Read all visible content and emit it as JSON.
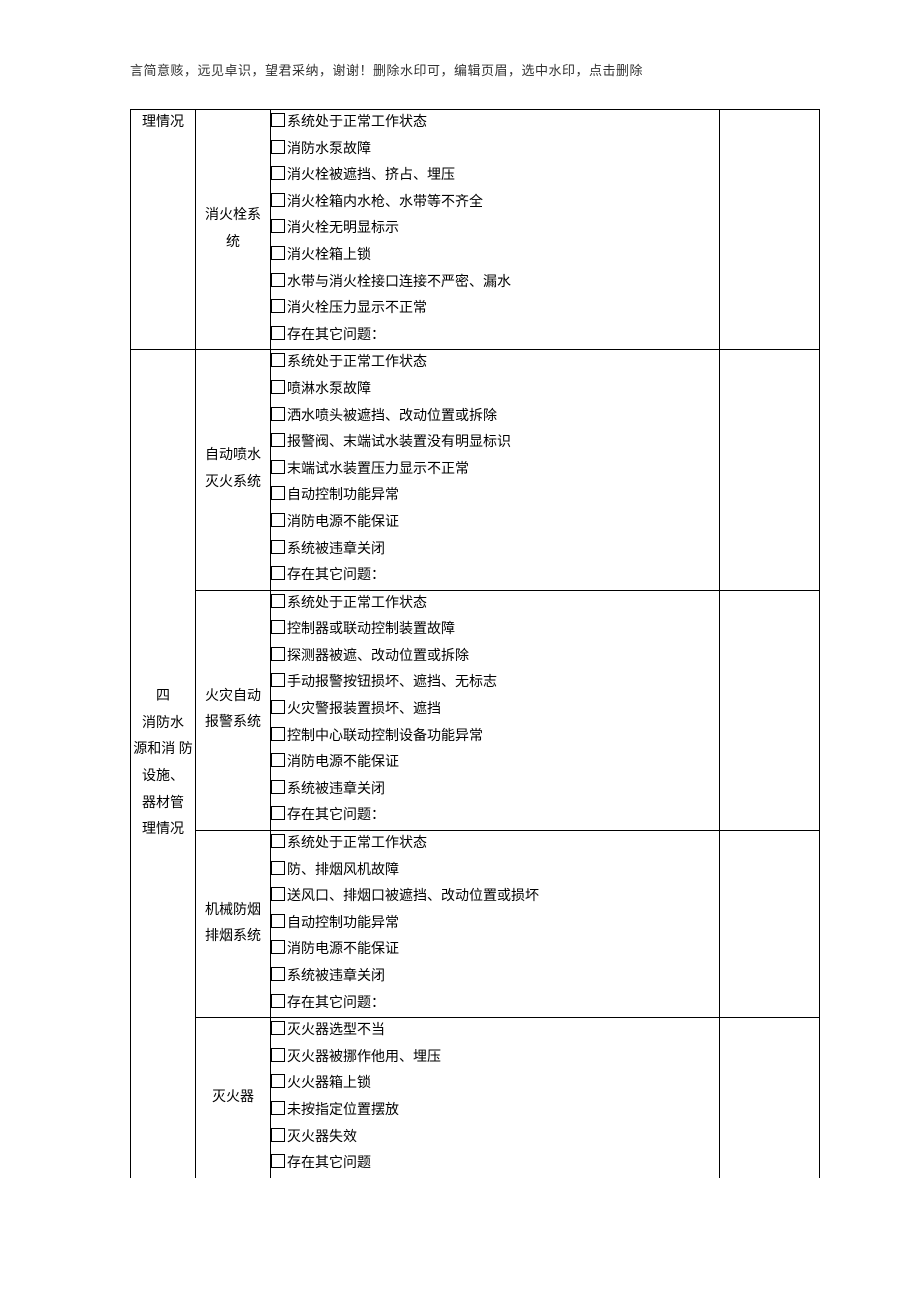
{
  "header_note": "言简意赅，远见卓识，望君采纳，谢谢！删除水印可，编辑页眉，选中水印，点击删除",
  "rowA_top": "理情况",
  "rowA_section": {
    "title": "四",
    "lines": [
      "消防水",
      "源和消 防",
      "设施、",
      "器材管",
      "理情况"
    ]
  },
  "groups": [
    {
      "label_lines": [
        "消火栓系",
        "统"
      ],
      "items": [
        "系统处于正常工作状态",
        "消防水泵故障",
        "消火栓被遮挡、挤占、埋压",
        "消火栓箱内水枪、水带等不齐全",
        "消火栓无明显标示",
        "消火栓箱上锁",
        "水带与消火栓接口连接不严密、漏水",
        "消火栓压力显示不正常",
        "存在其它问题："
      ]
    },
    {
      "label_lines": [
        "自动喷水",
        "灭火系统"
      ],
      "items": [
        "系统处于正常工作状态",
        "喷淋水泵故障",
        "洒水喷头被遮挡、改动位置或拆除",
        "报警阀、末端试水装置没有明显标识",
        "末端试水装置压力显示不正常",
        "自动控制功能异常",
        "消防电源不能保证",
        "系统被违章关闭",
        "存在其它问题："
      ]
    },
    {
      "label_lines": [
        "火灾自动",
        "报警系统"
      ],
      "items": [
        "系统处于正常工作状态",
        "控制器或联动控制装置故障",
        "探测器被遮、改动位置或拆除",
        "手动报警按钮损坏、遮挡、无标志",
        "火灾警报装置损坏、遮挡",
        "控制中心联动控制设备功能异常",
        "消防电源不能保证",
        "系统被违章关闭",
        "存在其它问题："
      ]
    },
    {
      "label_lines": [
        "机械防烟",
        "排烟系统"
      ],
      "items": [
        "系统处于正常工作状态",
        "防、排烟风机故障",
        "送风口、排烟口被遮挡、改动位置或损坏",
        "自动控制功能异常",
        "消防电源不能保证",
        "系统被违章关闭",
        "存在其它问题："
      ]
    },
    {
      "label_lines": [
        "灭火器"
      ],
      "items": [
        "灭火器选型不当",
        "灭火器被挪作他用、埋压",
        "火火器箱上锁",
        "未按指定位置摆放",
        "灭火器失效",
        "存在其它问题"
      ]
    }
  ]
}
